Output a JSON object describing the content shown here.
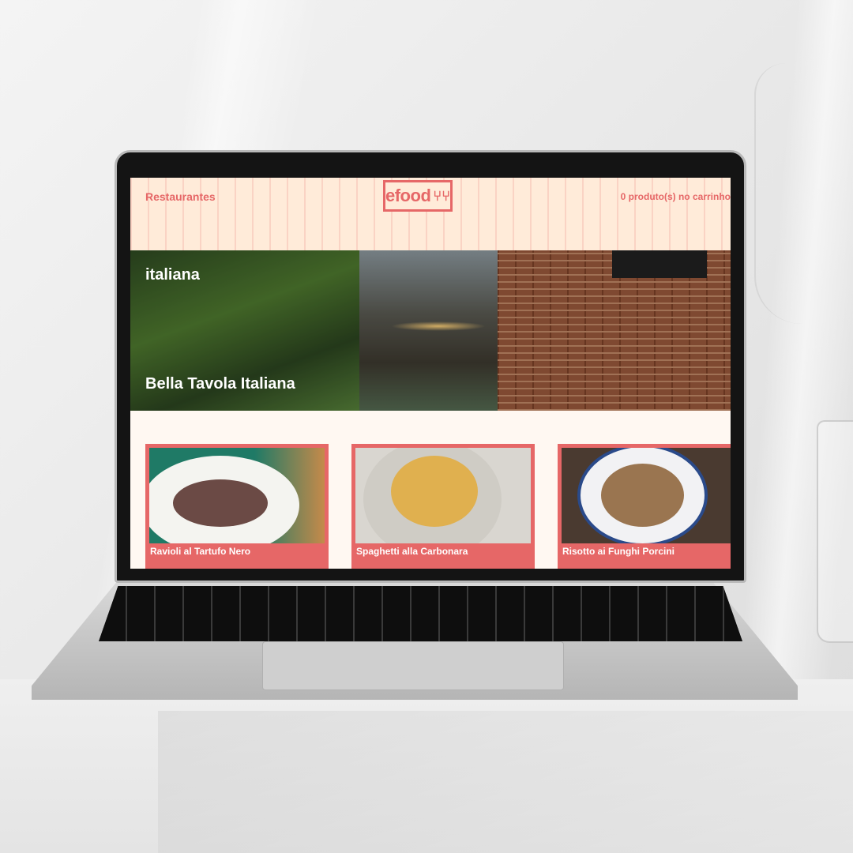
{
  "header": {
    "nav_label": "Restaurantes",
    "logo_text": "efood",
    "cart_label": "0 produto(s) no carrinho"
  },
  "banner": {
    "cuisine": "italiana",
    "restaurant_name": "Bella Tavola Italiana"
  },
  "dishes": [
    {
      "name": "Ravioli al Tartufo Nero"
    },
    {
      "name": "Spaghetti alla Carbonara"
    },
    {
      "name": "Risotto ai Funghi Porcini"
    }
  ],
  "colors": {
    "accent": "#e66767",
    "header_bg": "#ffebd9",
    "page_bg": "#fff8f2"
  },
  "icons": {
    "logo": "fork-knife-icon"
  }
}
